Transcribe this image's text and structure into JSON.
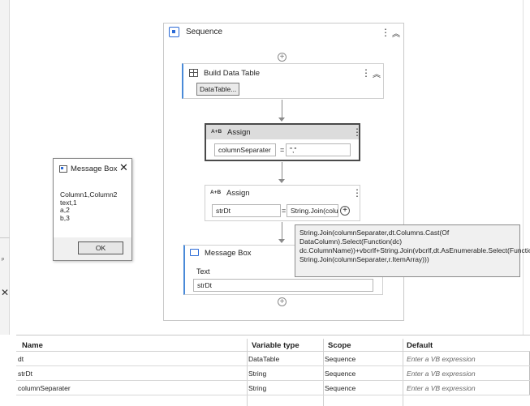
{
  "sequence": {
    "title": "Sequence"
  },
  "build_data_table": {
    "title": "Build Data Table",
    "button_label": "DataTable..."
  },
  "assign1": {
    "icon_text": "A+B",
    "title": "Assign",
    "to": "columnSeparater",
    "equals": "=",
    "value": "\",\""
  },
  "assign2": {
    "icon_text": "A+B",
    "title": "Assign",
    "to": "strDt",
    "equals": "=",
    "value": "String.Join(colu"
  },
  "tooltip": {
    "text": "String.Join(columnSeparater,dt.Columns.Cast(Of DataColumn).Select(Function(dc) dc.ColumnName))+vbcrlf+String.Join(vbcrlf,dt.AsEnumerable.Select(Function(r) String.Join(columnSeparater,r.ItemArray)))"
  },
  "message_box_activity": {
    "title": "Message Box",
    "text_label": "Text",
    "text_value": "strDt"
  },
  "dialog": {
    "title": "Message Box",
    "body": "Column1,Column2\ntext,1\na,2\nb,3",
    "ok_label": "OK"
  },
  "variables": {
    "headers": {
      "name": "Name",
      "type": "Variable type",
      "scope": "Scope",
      "default": "Default"
    },
    "rows": [
      {
        "name": "dt",
        "type": "DataTable",
        "scope": "Sequence",
        "default": "Enter a VB expression"
      },
      {
        "name": "strDt",
        "type": "String",
        "scope": "Sequence",
        "default": "Enter a VB expression"
      },
      {
        "name": "columnSeparater",
        "type": "String",
        "scope": "Sequence",
        "default": "Enter a VB expression"
      }
    ]
  },
  "icons": {
    "kebab": "⋮",
    "collapse": "︽",
    "close": "✕",
    "plus": "+",
    "pin": "ᵖ"
  }
}
